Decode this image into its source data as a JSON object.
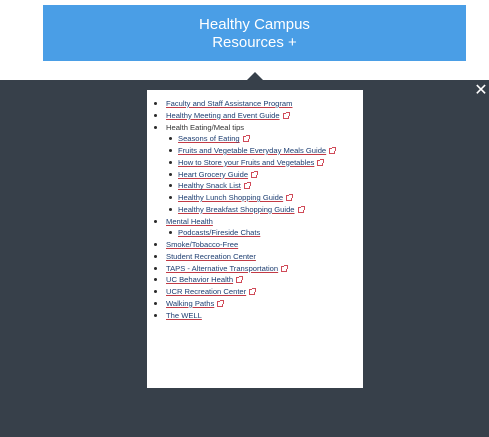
{
  "banner": {
    "title": "Healthy Campus",
    "subtitle": "Resources +"
  },
  "close_label": "✕",
  "resources": {
    "faculty_staff": "Faculty and Staff Assistance Program",
    "meeting_guide": "Healthy Meeting and Event Guide",
    "eating_tips": "Health Eating/Meal tips",
    "seasons": "Seasons of Eating",
    "fruits_meals": "Fruits and Vegetable Everyday Meals Guide",
    "store_fruits": "How to Store your Fruits and Vegetables",
    "heart_grocery": "Heart Grocery Guide",
    "snack_list": "Healthy Snack List",
    "lunch_guide": "Healthy Lunch Shopping Guide",
    "breakfast_guide": "Healthy Breakfast Shopping Guide",
    "mental_health": "Mental Health",
    "podcasts": "Podcasts/Fireside Chats",
    "smoke_free": "Smoke/Tobacco-Free",
    "rec_center_student": "Student Recreation Center",
    "taps": "TAPS - Alternative Transportation",
    "uc_behavior": "UC Behavior Health",
    "ucr_rec": "UCR Recreation Center",
    "walking": "Walking Paths",
    "well": "The WELL"
  }
}
